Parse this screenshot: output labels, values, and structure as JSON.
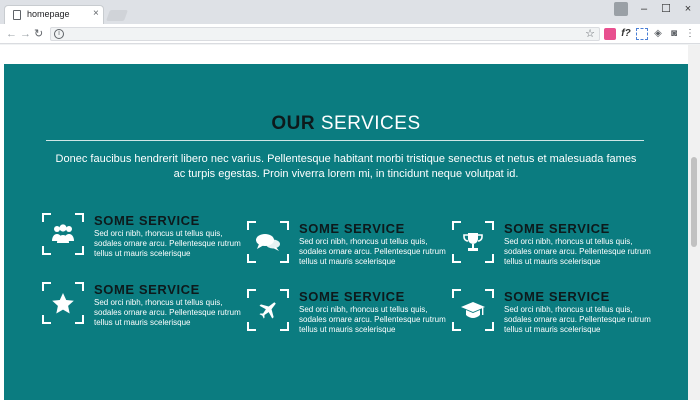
{
  "browser": {
    "tab_title": "homepage",
    "tab_close": "×",
    "minimize": "–",
    "maximize": "☐",
    "close": "×",
    "url": "",
    "ext_label": "f?"
  },
  "services_section": {
    "heading_strong": "OUR",
    "heading_light": "SERVICES",
    "intro": "Donec faucibus hendrerit libero nec varius. Pellentesque habitant morbi tristique senectus et netus et malesuada fames ac turpis egestas. Proin viverra lorem mi, in tincidunt neque volutpat id.",
    "items": [
      {
        "title": "SOME SERVICE",
        "icon": "users-icon",
        "text": "Sed orci nibh, rhoncus ut tellus quis, sodales ornare arcu. Pellentesque rutrum tellus ut mauris scelerisque"
      },
      {
        "title": "SOME SERVICE",
        "icon": "chat-icon",
        "text": "Sed orci nibh, rhoncus ut tellus quis, sodales ornare arcu. Pellentesque rutrum tellus ut mauris scelerisque"
      },
      {
        "title": "SOME SERVICE",
        "icon": "trophy-icon",
        "text": "Sed orci nibh, rhoncus ut tellus quis, sodales ornare arcu. Pellentesque rutrum tellus ut mauris scelerisque"
      },
      {
        "title": "SOME SERVICE",
        "icon": "star-icon",
        "text": "Sed orci nibh, rhoncus ut tellus quis, sodales ornare arcu. Pellentesque rutrum tellus ut mauris scelerisque"
      },
      {
        "title": "SOME SERVICE",
        "icon": "airplane-icon",
        "text": "Sed orci nibh, rhoncus ut tellus quis, sodales ornare arcu. Pellentesque rutrum tellus ut mauris scelerisque"
      },
      {
        "title": "SOME SERVICE",
        "icon": "graduation-cap-icon",
        "text": "Sed orci nibh, rhoncus ut tellus quis, sodales ornare arcu. Pellentesque rutrum tellus ut mauris scelerisque"
      }
    ]
  },
  "colors": {
    "section_bg": "#0b7c80",
    "heading_dark": "#0d1a1c"
  }
}
